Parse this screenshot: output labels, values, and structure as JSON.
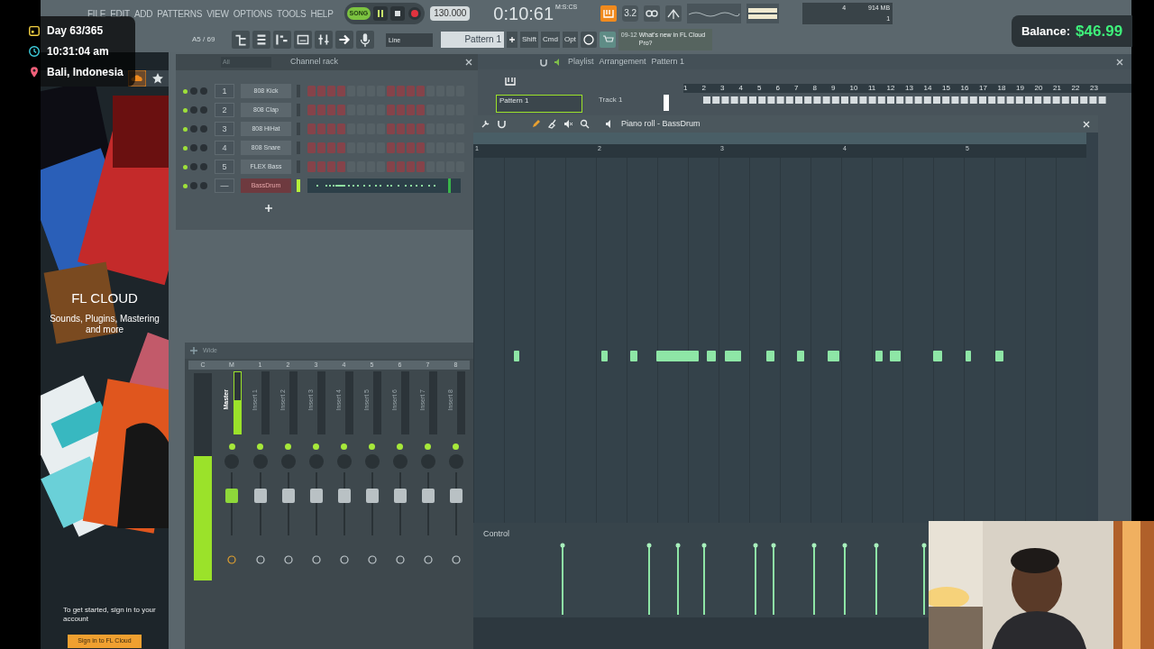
{
  "overlay": {
    "day": "Day 63/365",
    "time": "10:31:04 am",
    "location": "Bali, Indonesia"
  },
  "balance": {
    "label": "Balance:",
    "amount": "$46.99"
  },
  "menu": [
    "FILE",
    "EDIT",
    "ADD",
    "PATTERNS",
    "VIEW",
    "OPTIONS",
    "TOOLS",
    "HELP"
  ],
  "transport": {
    "mode": "SONG",
    "song_selected": true,
    "tempo": "130.000",
    "time": "0:10:61",
    "time_format": "M:S:CS"
  },
  "toolbar": {
    "rate": "3.2",
    "cpu": "4",
    "memory": "914 MB",
    "polyphony": "1",
    "hint": "A5 / 69",
    "snap": "Line",
    "pattern": "Pattern 1",
    "keys": [
      "Shift",
      "Cmd",
      "Opt"
    ],
    "news_date": "09-12",
    "news": "What's new in FL Cloud Pro?"
  },
  "browser": {
    "brand": "FL CLOUD",
    "tagline": "Sounds, Plugins, Mastering and more",
    "prompt": "To get started, sign in to your account",
    "button": "Sign in to FL Cloud"
  },
  "channel_rack": {
    "filter": "All",
    "title": "Channel rack",
    "channels": [
      {
        "number": "1",
        "name": "808 Kick",
        "selected": false,
        "kind": "steps"
      },
      {
        "number": "2",
        "name": "808 Clap",
        "selected": false,
        "kind": "steps"
      },
      {
        "number": "3",
        "name": "808 HiHat",
        "selected": false,
        "kind": "steps"
      },
      {
        "number": "4",
        "name": "808 Snare",
        "selected": false,
        "kind": "steps"
      },
      {
        "number": "5",
        "name": "FLEX Bass",
        "selected": false,
        "kind": "steps"
      },
      {
        "number": "—",
        "name": "BassDrum",
        "selected": true,
        "kind": "piano_roll"
      }
    ]
  },
  "mixer": {
    "mode": "Wide",
    "tracks": [
      {
        "header": "C",
        "kind": "current",
        "level": 0.6
      },
      {
        "header": "M",
        "label": "Master",
        "kind": "master",
        "level": 0.55
      },
      {
        "header": "1",
        "label": "Insert 1",
        "kind": "insert"
      },
      {
        "header": "2",
        "label": "Insert 2",
        "kind": "insert"
      },
      {
        "header": "3",
        "label": "Insert 3",
        "kind": "insert"
      },
      {
        "header": "4",
        "label": "Insert 4",
        "kind": "insert"
      },
      {
        "header": "5",
        "label": "Insert 5",
        "kind": "insert"
      },
      {
        "header": "6",
        "label": "Insert 6",
        "kind": "insert"
      },
      {
        "header": "7",
        "label": "Insert 7",
        "kind": "insert"
      },
      {
        "header": "8",
        "label": "Insert 8",
        "kind": "insert"
      }
    ]
  },
  "playlist": {
    "title": "Playlist",
    "breadcrumb": [
      "Arrangement",
      "Pattern 1"
    ],
    "pattern": "Pattern 1",
    "track": "Track 1",
    "ruler": [
      "1",
      "2",
      "3",
      "4",
      "5",
      "6",
      "7",
      "8",
      "9",
      "10",
      "11",
      "12",
      "13",
      "14",
      "15",
      "16",
      "17",
      "18",
      "19",
      "20",
      "21",
      "22",
      "23"
    ]
  },
  "piano_roll": {
    "title": "Piano roll - BassDrum",
    "ruler": [
      "1",
      "2",
      "3",
      "4",
      "5"
    ],
    "control": "Control"
  }
}
